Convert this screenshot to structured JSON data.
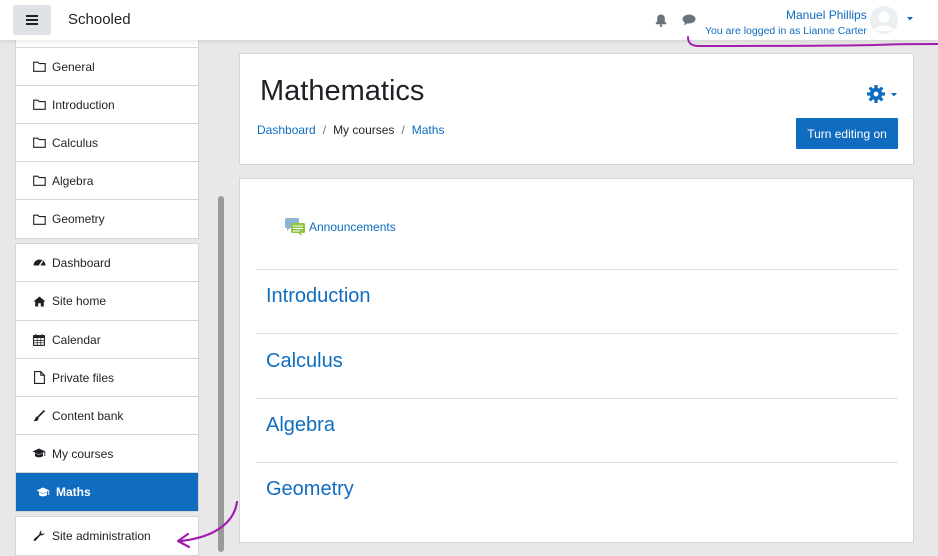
{
  "navbar": {
    "brand": "Schooled",
    "user_name": "Manuel Phillips",
    "logged_in_as": "You are logged in as Lianne Carter",
    "icons": [
      "menu-icon",
      "bell-icon",
      "chat-icon",
      "user-avatar",
      "caret-down-icon"
    ]
  },
  "sidebar": {
    "course_sections": [
      {
        "label": "General",
        "icon": "folder-icon"
      },
      {
        "label": "Introduction",
        "icon": "folder-icon"
      },
      {
        "label": "Calculus",
        "icon": "folder-icon"
      },
      {
        "label": "Algebra",
        "icon": "folder-icon"
      },
      {
        "label": "Geometry",
        "icon": "folder-icon"
      }
    ],
    "nav": [
      {
        "label": "Dashboard",
        "icon": "dashboard-icon"
      },
      {
        "label": "Site home",
        "icon": "home-icon"
      }
    ],
    "personal": [
      {
        "label": "Calendar",
        "icon": "calendar-icon"
      },
      {
        "label": "Private files",
        "icon": "file-icon"
      },
      {
        "label": "Content bank",
        "icon": "brush-icon"
      },
      {
        "label": "My courses",
        "icon": "graduation-cap-icon"
      },
      {
        "label": "Maths",
        "icon": "graduation-cap-icon",
        "active": true
      }
    ],
    "admin": [
      {
        "label": "Site administration",
        "icon": "wrench-icon"
      }
    ]
  },
  "header": {
    "title": "Mathematics",
    "breadcrumb": [
      {
        "label": "Dashboard",
        "link": true
      },
      {
        "label": "My courses",
        "link": false
      },
      {
        "label": "Maths",
        "link": true
      }
    ],
    "edit_button": "Turn editing on"
  },
  "content": {
    "announcements": "Announcements",
    "sections": [
      "Introduction",
      "Calculus",
      "Algebra",
      "Geometry"
    ]
  },
  "colors": {
    "brand_blue": "#0f6cbf",
    "annotation_purple": "#a21caf"
  }
}
